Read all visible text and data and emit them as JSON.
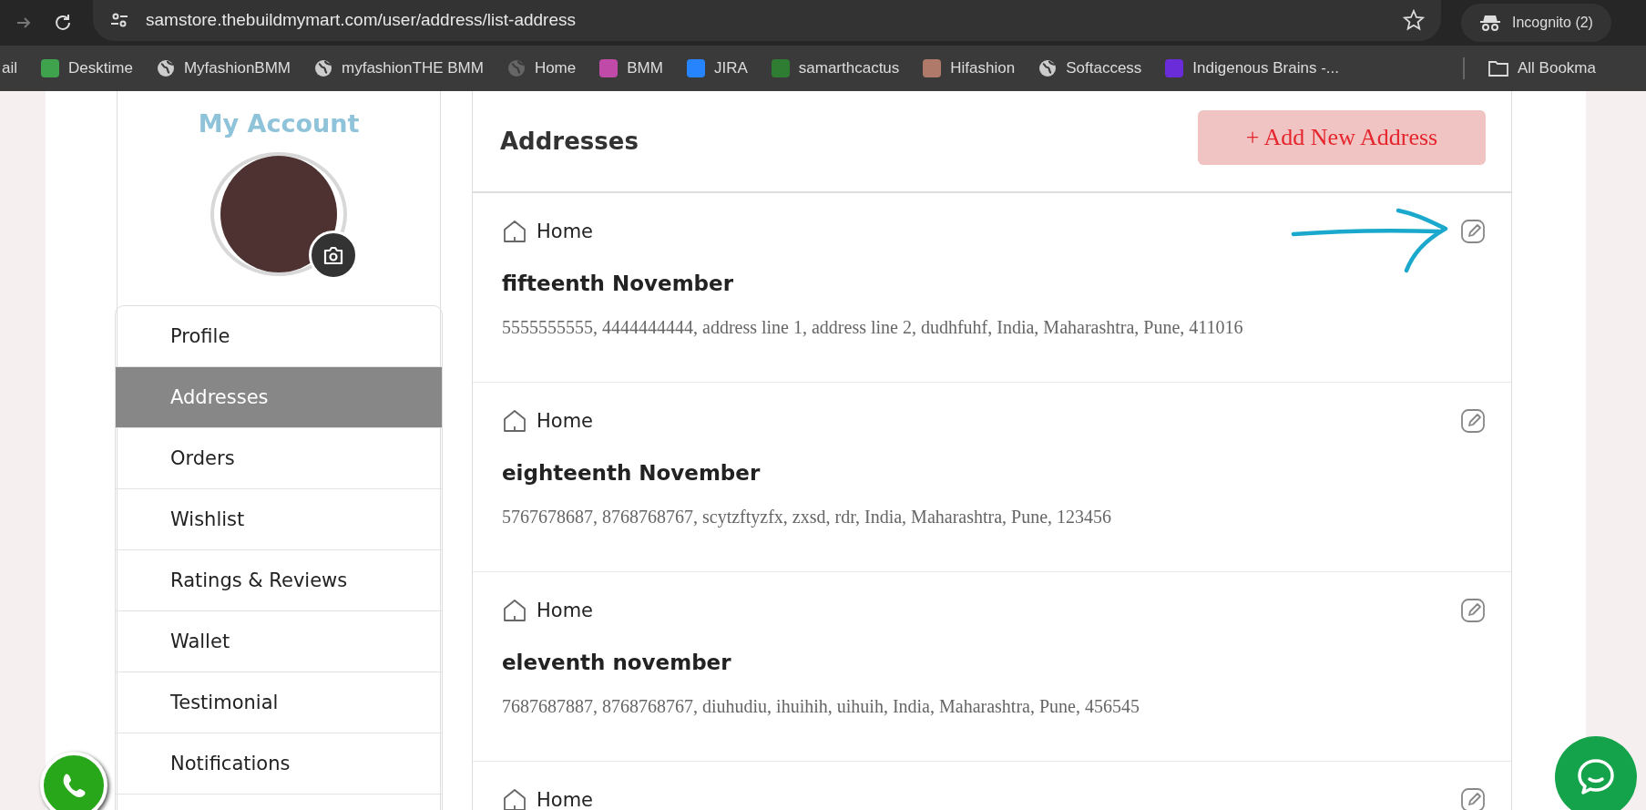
{
  "browser": {
    "url": "samstore.thebuildmymart.com/user/address/list-address",
    "profile": "Incognito (2)"
  },
  "bookmarks": [
    {
      "label": "ail",
      "kind": "none"
    },
    {
      "label": "Desktime",
      "kind": "favicon",
      "color": "#3fa34d"
    },
    {
      "label": "MyfashionBMM",
      "kind": "globe"
    },
    {
      "label": "myfashionTHE BMM",
      "kind": "globe"
    },
    {
      "label": "Home",
      "kind": "darkglobe"
    },
    {
      "label": "BMM",
      "kind": "favicon",
      "color": "#c04aa8"
    },
    {
      "label": "JIRA",
      "kind": "favicon",
      "color": "#2684ff"
    },
    {
      "label": "samarthcactus",
      "kind": "favicon",
      "color": "#2e7d32"
    },
    {
      "label": "Hifashion",
      "kind": "favicon",
      "color": "#b07a6a"
    },
    {
      "label": "Softaccess",
      "kind": "globe"
    },
    {
      "label": "Indigenous Brains -...",
      "kind": "favicon",
      "color": "#6a2bd8"
    }
  ],
  "all_bookmarks": "All Bookma",
  "sidebar": {
    "title": "My Account",
    "items": [
      {
        "label": "Profile",
        "selected": false
      },
      {
        "label": "Addresses",
        "selected": true
      },
      {
        "label": "Orders",
        "selected": false
      },
      {
        "label": "Wishlist",
        "selected": false
      },
      {
        "label": "Ratings & Reviews",
        "selected": false
      },
      {
        "label": "Wallet",
        "selected": false
      },
      {
        "label": "Testimonial",
        "selected": false
      },
      {
        "label": "Notifications",
        "selected": false
      }
    ]
  },
  "main": {
    "title": "Addresses",
    "add_button": "+ Add New Address",
    "addresses": [
      {
        "type": "Home",
        "name": "fifteenth November",
        "line": "5555555555, 4444444444, address line 1, address line 2, dudhfuhf, India, Maharashtra, Pune, 411016",
        "annotated": true
      },
      {
        "type": "Home",
        "name": "eighteenth November",
        "line": "5767678687, 8768768767, scytzftyzfx, zxsd, rdr, India, Maharashtra, Pune, 123456",
        "annotated": false
      },
      {
        "type": "Home",
        "name": "eleventh november",
        "line": "7687687887, 8768768767, diuhudiu, ihuihih, uihuih, India, Maharashtra, Pune, 456545",
        "annotated": false
      },
      {
        "type": "Home",
        "annotated": false
      }
    ]
  }
}
